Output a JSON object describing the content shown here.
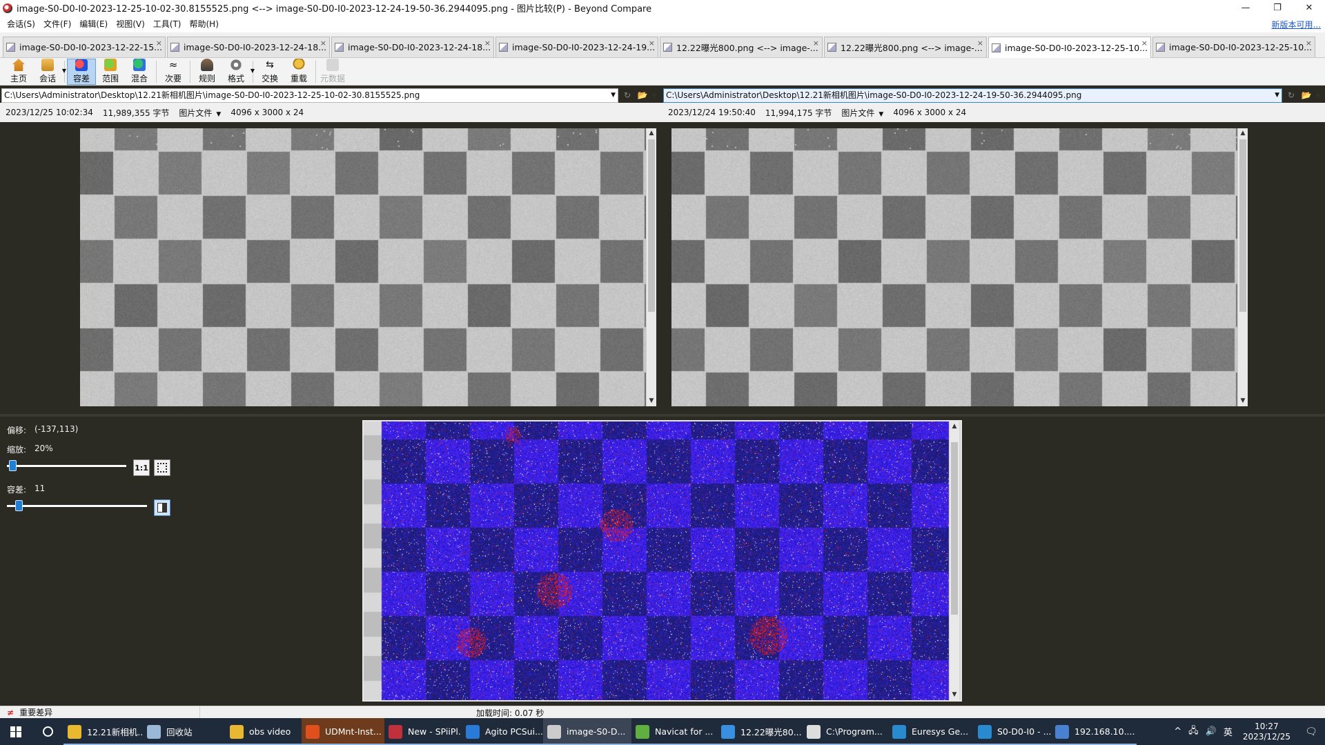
{
  "titlebar": {
    "title": "image-S0-D0-I0-2023-12-25-10-02-30.8155525.png <--> image-S0-D0-I0-2023-12-24-19-50-36.2944095.png - 图片比较(P) - Beyond Compare",
    "minimize": "—",
    "restore": "❐",
    "close": "✕"
  },
  "menu": {
    "items": [
      "会话(S)",
      "文件(F)",
      "编辑(E)",
      "视图(V)",
      "工具(T)",
      "帮助(H)"
    ],
    "update_link": "新版本可用..."
  },
  "tabs": [
    {
      "label": "image-S0-D0-I0-2023-12-22-15...",
      "active": false
    },
    {
      "label": "image-S0-D0-I0-2023-12-24-18...",
      "active": false
    },
    {
      "label": "image-S0-D0-I0-2023-12-24-18...",
      "active": false
    },
    {
      "label": "image-S0-D0-I0-2023-12-24-19...",
      "active": false
    },
    {
      "label": "12.22曝光800.png <--> image-...",
      "active": false
    },
    {
      "label": "12.22曝光800.png <--> image-...",
      "active": false
    },
    {
      "label": "image-S0-D0-I0-2023-12-25-10...",
      "active": true
    },
    {
      "label": "image-S0-D0-I0-2023-12-25-10...",
      "active": false
    }
  ],
  "tab_close": "×",
  "toolbar": {
    "home": "主页",
    "session": "会话",
    "tolerance": "容差",
    "range": "范围",
    "blend": "混合",
    "minor": "次要",
    "rules": "规则",
    "format": "格式",
    "swap": "交换",
    "reload": "重载",
    "metadata": "元数据"
  },
  "left": {
    "path": "C:\\Users\\Administrator\\Desktop\\12.21新相机图片\\image-S0-D0-I0-2023-12-25-10-02-30.8155525.png",
    "date": "2023/12/25 10:02:34",
    "size": "11,989,355 字节",
    "filetype": "图片文件",
    "dims": "4096 x 3000 x 24"
  },
  "right": {
    "path": "C:\\Users\\Administrator\\Desktop\\12.21新相机图片\\image-S0-D0-I0-2023-12-24-19-50-36.2944095.png",
    "date": "2023/12/24 19:50:40",
    "size": "11,994,175 字节",
    "filetype": "图片文件",
    "dims": "4096 x 3000 x 24"
  },
  "controls": {
    "offset_label": "偏移:",
    "offset_value": "(-137,113)",
    "zoom_label": "缩放:",
    "zoom_value": "20%",
    "zoom_level": 0.02,
    "actual_size": "1:1",
    "tolerance_label": "容差:",
    "tolerance_value": "11",
    "tolerance_level": 0.06
  },
  "status": {
    "diff_mark": "≠",
    "diff_label": "重要差异",
    "load_time": "加载时间: 0.07 秒"
  },
  "colors": {
    "diff_blue": "#2a1fd8",
    "diff_dark": "#1a1a78",
    "diff_red": "#d42020",
    "accent": "#1e7fd8"
  },
  "taskbar": {
    "apps": [
      {
        "label": "12.21新相机...",
        "icon": "folder-icon",
        "color": "#e8b830"
      },
      {
        "label": "回收站",
        "icon": "recycle-bin-icon",
        "color": "#9ab8d8"
      },
      {
        "label": "obs video",
        "icon": "folder-icon",
        "color": "#e8b830"
      },
      {
        "label": "UDMnt-Inst...",
        "icon": "installer-icon",
        "color": "#e0501c"
      },
      {
        "label": "New - SPiiPl...",
        "icon": "spiiplus-icon",
        "color": "#c0303a"
      },
      {
        "label": "Agito PCSui...",
        "icon": "agito-icon",
        "color": "#2a7ad8"
      },
      {
        "label": "image-S0-D...",
        "icon": "beyond-compare-icon",
        "color": "#cccccc"
      },
      {
        "label": "Navicat for ...",
        "icon": "navicat-icon",
        "color": "#5fb040"
      },
      {
        "label": "12.22曝光80...",
        "icon": "image-viewer-icon",
        "color": "#3a90e0"
      },
      {
        "label": "C:\\Program...",
        "icon": "console-icon",
        "color": "#dddddd"
      },
      {
        "label": "Euresys Ge...",
        "icon": "euresys-icon",
        "color": "#2a8ad0"
      },
      {
        "label": "S0-D0-I0 - ...",
        "icon": "euresys-icon",
        "color": "#2a8ad0"
      },
      {
        "label": "192.168.10....",
        "icon": "remote-desktop-icon",
        "color": "#4a80d0"
      }
    ],
    "tray": {
      "chevron": "^",
      "ime": "英",
      "time": "10:27",
      "date": "2023/12/25"
    }
  }
}
